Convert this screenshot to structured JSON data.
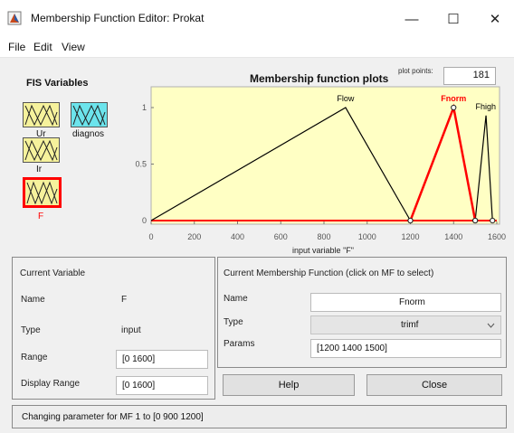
{
  "window": {
    "title": "Membership Function Editor: Prokat",
    "minimize_glyph": "—",
    "maximize_glyph": "☐",
    "close_glyph": "✕"
  },
  "menu": [
    "File",
    "Edit",
    "View"
  ],
  "fis": {
    "title": "FIS Variables",
    "inputs": [
      "Ur",
      "Ir",
      "F"
    ],
    "outputs": [
      "diagnos"
    ],
    "selected": "F",
    "colors": {
      "input": "#f6f29c",
      "output": "#6ce4ec",
      "selected_border": "#ff0000"
    }
  },
  "plot": {
    "title": "Membership function plots",
    "points_label": "plot points:",
    "points_value": "181",
    "xlabel": "input variable \"F\"",
    "background": "#ffffc4"
  },
  "chart_data": {
    "type": "line",
    "title": "Membership function plots",
    "xlabel": "input variable \"F\"",
    "ylabel": "",
    "xlim": [
      0,
      1600
    ],
    "ylim": [
      0,
      1
    ],
    "x_ticks": [
      0,
      200,
      400,
      600,
      800,
      1000,
      1200,
      1400,
      1600
    ],
    "y_ticks": [
      0,
      0.5,
      1
    ],
    "series": [
      {
        "name": "Flow",
        "color": "#000000",
        "selected": false,
        "x": [
          0,
          900,
          1200
        ],
        "y": [
          0,
          1,
          0
        ]
      },
      {
        "name": "Fnorm",
        "color": "#ff0000",
        "selected": true,
        "x": [
          1200,
          1400,
          1500
        ],
        "y": [
          0,
          1,
          0
        ]
      },
      {
        "name": "Fhigh",
        "color": "#000000",
        "selected": false,
        "x": [
          1500,
          1550,
          1580
        ],
        "y": [
          0,
          0.93,
          0
        ]
      }
    ]
  },
  "current_variable": {
    "header": "Current Variable",
    "name_label": "Name",
    "name_value": "F",
    "type_label": "Type",
    "type_value": "input",
    "range_label": "Range",
    "range_value": "[0 1600]",
    "display_range_label": "Display Range",
    "display_range_value": "[0 1600]"
  },
  "current_mf": {
    "header": "Current Membership Function (click on MF to select)",
    "name_label": "Name",
    "name_value": "Fnorm",
    "type_label": "Type",
    "type_value": "trimf",
    "params_label": "Params",
    "params_value": "[1200 1400 1500]"
  },
  "buttons": {
    "help": "Help",
    "close": "Close"
  },
  "status": "Changing parameter for MF 1 to  [0 900 1200]"
}
